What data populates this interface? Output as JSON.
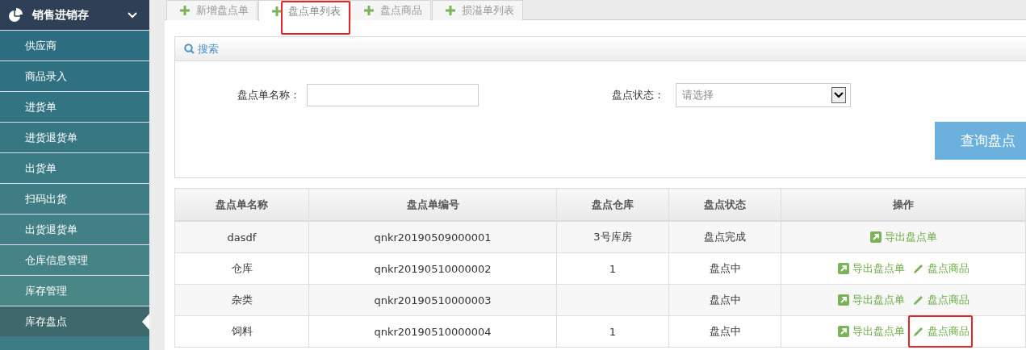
{
  "sidebar": {
    "title": "销售进销存",
    "expanded": true,
    "items": [
      {
        "label": "供应商",
        "selected": false
      },
      {
        "label": "商品录入",
        "selected": false
      },
      {
        "label": "进货单",
        "selected": false
      },
      {
        "label": "进货退货单",
        "selected": false
      },
      {
        "label": "出货单",
        "selected": false
      },
      {
        "label": "扫码出货",
        "selected": false
      },
      {
        "label": "出货退货单",
        "selected": false
      },
      {
        "label": "仓库信息管理",
        "selected": false
      },
      {
        "label": "库存管理",
        "selected": false
      },
      {
        "label": "库存盘点",
        "selected": true
      }
    ]
  },
  "tabs": [
    {
      "label": "新增盘点单",
      "selected": false,
      "highlighted": false
    },
    {
      "label": "盘点单列表",
      "selected": true,
      "highlighted": true
    },
    {
      "label": "盘点商品",
      "selected": false,
      "highlighted": false
    },
    {
      "label": "损溢单列表",
      "selected": false,
      "highlighted": false
    }
  ],
  "search": {
    "title": "搜索",
    "name_label": "盘点单名称：",
    "status_label": "盘点状态：",
    "status_placeholder": "请选择",
    "button": "查询盘点"
  },
  "table": {
    "columns": [
      "盘点单名称",
      "盘点单编号",
      "盘点仓库",
      "盘点状态",
      "操作"
    ],
    "rows": [
      {
        "cells": [
          "dasdf",
          "qnkr20190509000001",
          "3号库房",
          "盘点完成"
        ],
        "actions": [
          {
            "kind": "export",
            "label": "导出盘点单",
            "highlighted": false
          }
        ]
      },
      {
        "cells": [
          "仓库",
          "qnkr20190510000002",
          "1",
          "盘点中"
        ],
        "actions": [
          {
            "kind": "export",
            "label": "导出盘点单",
            "highlighted": false
          },
          {
            "kind": "edit",
            "label": "盘点商品",
            "highlighted": false
          }
        ]
      },
      {
        "cells": [
          "杂类",
          "qnkr20190510000003",
          "",
          "盘点中"
        ],
        "actions": [
          {
            "kind": "export",
            "label": "导出盘点单",
            "highlighted": false
          },
          {
            "kind": "edit",
            "label": "盘点商品",
            "highlighted": false
          }
        ]
      },
      {
        "cells": [
          "饲料",
          "qnkr20190510000004",
          "1",
          "盘点中"
        ],
        "actions": [
          {
            "kind": "export",
            "label": "导出盘点单",
            "highlighted": false
          },
          {
            "kind": "edit",
            "label": "盘点商品",
            "highlighted": true
          }
        ]
      }
    ]
  }
}
